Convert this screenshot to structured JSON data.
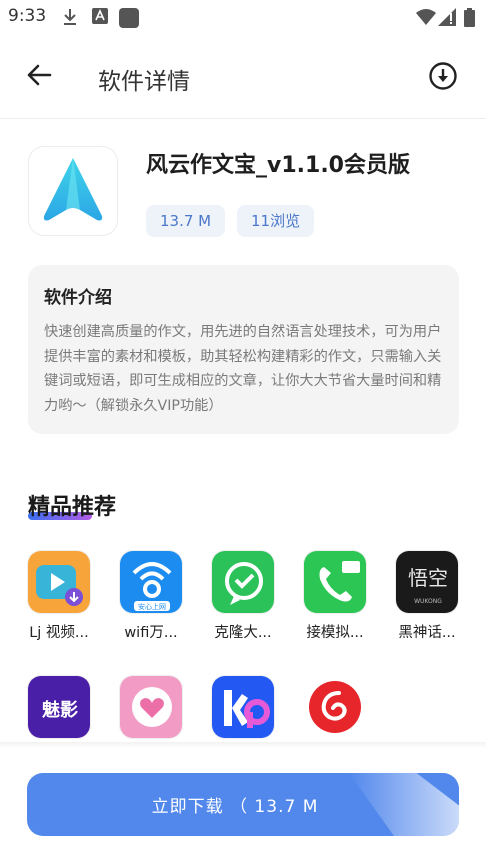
{
  "status_bar": {
    "time": "9:33"
  },
  "app_bar": {
    "title": "软件详情"
  },
  "app": {
    "name": "风云作文宝_v1.1.0会员版",
    "size": "13.7 M",
    "views": "11浏览"
  },
  "intro": {
    "title": "软件介绍",
    "text": "快速创建高质量的作文，用先进的自然语言处理技术，可为用户提供丰富的素材和模板，助其轻松构建精彩的作文，只需输入关键词或短语，即可生成相应的文章，让你大大节省大量时间和精力哟～（解锁永久VIP功能）"
  },
  "recommend": {
    "title": "精品推荐",
    "items": [
      {
        "label": "Lj 视频..."
      },
      {
        "label": "wifi万..."
      },
      {
        "label": "克隆大..."
      },
      {
        "label": "接模拟..."
      },
      {
        "label": "黑神话..."
      },
      {
        "label": ""
      },
      {
        "label": ""
      },
      {
        "label": ""
      },
      {
        "label": ""
      }
    ],
    "badge_text": "安心上网",
    "wukong_text": "悟空",
    "wukong_sub": "WUKONG",
    "meiying_text": "魅影"
  },
  "download_button": {
    "label": "立即下载 （ 13.7 M"
  },
  "colors": {
    "accent": "#5288ec",
    "chip_bg": "#eef3fa",
    "chip_text": "#4b78c8"
  }
}
